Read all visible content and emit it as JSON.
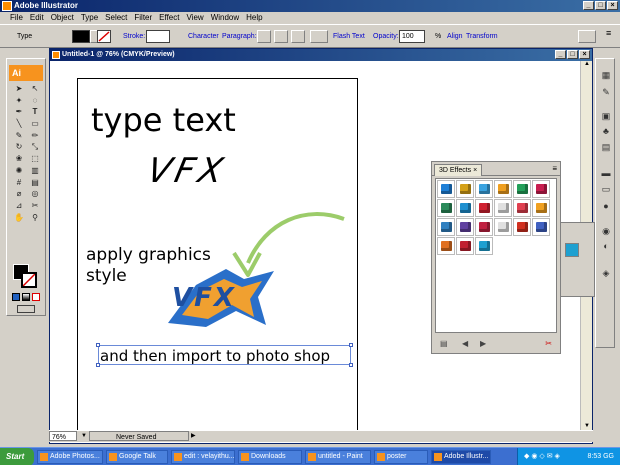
{
  "app": {
    "title": "Adobe Illustrator"
  },
  "menu": [
    "File",
    "Edit",
    "Object",
    "Type",
    "Select",
    "Filter",
    "Effect",
    "View",
    "Window",
    "Help"
  ],
  "controlbar": {
    "tool_label": "Type",
    "stroke_label": "Stroke:",
    "character_link": "Character",
    "paragraph_link": "Paragraph:",
    "flash_text_link": "Flash Text",
    "opacity_label": "Opacity:",
    "opacity_value": "100",
    "opacity_unit": "%",
    "align_link": "Align",
    "transform_link": "Transform"
  },
  "tools": {
    "logo": "Ai"
  },
  "document": {
    "title": "Untitled-1 @ 76% (CMYK/Preview)",
    "texts": {
      "type_text": "type text",
      "vfx_plain": "VFX",
      "apply_line1": "apply graphics",
      "apply_line2": "style",
      "vfx_styled": "VFX",
      "import_text": "and then import to photo shop"
    }
  },
  "fx_panel": {
    "tab_label": "3D Effects",
    "swatches": [
      "#1e7fd6",
      "#d4a017",
      "#3aa3e0",
      "#f0a020",
      "#23a05a",
      "#c81e50",
      "#2a8a5a",
      "#1e90d0",
      "#d02030",
      "#e0e0e0",
      "#e04050",
      "#f0a020",
      "#3080c0",
      "#6040a0",
      "#c02040",
      "#e0e0e0",
      "#d03020",
      "#4060c0",
      "#e07020",
      "#c02030",
      "#1ea0d0"
    ]
  },
  "status": {
    "zoom": "76%",
    "save_state": "Never Saved"
  },
  "taskbar": {
    "start": "Start",
    "buttons": [
      "Adobe Photos...",
      "Google Talk",
      "edit : velayithu...",
      "Downloads",
      "untitled - Paint",
      "poster",
      "Adobe Illustr..."
    ],
    "active_index": 6,
    "clock": "8:53 GG"
  }
}
